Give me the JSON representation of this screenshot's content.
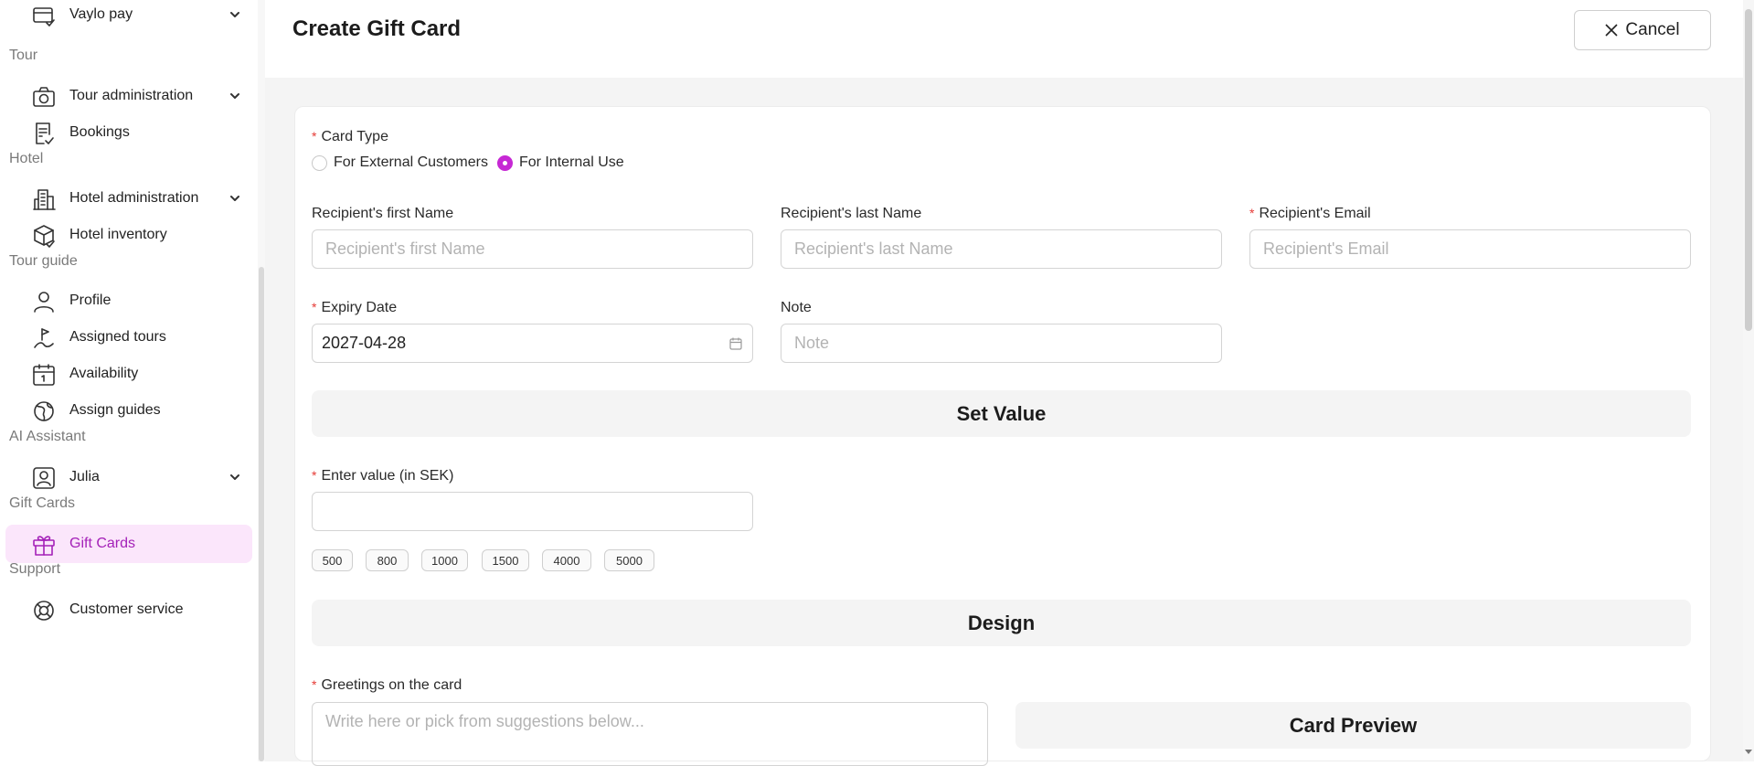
{
  "sidebar": {
    "items": [
      {
        "type": "item",
        "label": "Vaylo pay",
        "icon": "card-check-icon",
        "chevron": true
      },
      {
        "type": "section",
        "label": "Tour"
      },
      {
        "type": "item",
        "label": "Tour administration",
        "icon": "camera-icon",
        "chevron": true
      },
      {
        "type": "item",
        "label": "Bookings",
        "icon": "document-check-icon"
      },
      {
        "type": "section",
        "label": "Hotel"
      },
      {
        "type": "item",
        "label": "Hotel administration",
        "icon": "building-icon",
        "chevron": true
      },
      {
        "type": "item",
        "label": "Hotel inventory",
        "icon": "box-check-icon"
      },
      {
        "type": "section",
        "label": "Tour guide"
      },
      {
        "type": "item",
        "label": "Profile",
        "icon": "user-icon"
      },
      {
        "type": "item",
        "label": "Assigned tours",
        "icon": "flag-route-icon"
      },
      {
        "type": "item",
        "label": "Availability",
        "icon": "calendar-icon"
      },
      {
        "type": "item",
        "label": "Assign guides",
        "icon": "globe-icon"
      },
      {
        "type": "section",
        "label": "AI Assistant"
      },
      {
        "type": "item",
        "label": "Julia",
        "icon": "user-square-icon",
        "chevron": true
      },
      {
        "type": "section",
        "label": "Gift Cards"
      },
      {
        "type": "item",
        "label": "Gift Cards",
        "icon": "gift-icon",
        "active": true
      },
      {
        "type": "section",
        "label": "Support"
      },
      {
        "type": "item",
        "label": "Customer service",
        "icon": "lifebuoy-icon"
      }
    ]
  },
  "header": {
    "title": "Create Gift Card",
    "cancel_label": "Cancel"
  },
  "form": {
    "card_type": {
      "label": "Card Type",
      "options": [
        "For External Customers",
        "For Internal Use"
      ],
      "selected": "For Internal Use"
    },
    "first_name": {
      "label": "Recipient's first Name",
      "placeholder": "Recipient's first Name",
      "value": ""
    },
    "last_name": {
      "label": "Recipient's last Name",
      "placeholder": "Recipient's last Name",
      "value": ""
    },
    "email": {
      "label": "Recipient's Email",
      "placeholder": "Recipient's Email",
      "value": ""
    },
    "expiry": {
      "label": "Expiry Date",
      "value": "2027-04-28"
    },
    "note": {
      "label": "Note",
      "placeholder": "Note",
      "value": ""
    },
    "set_value_title": "Set Value",
    "value_field": {
      "label": "Enter value (in SEK)",
      "value": ""
    },
    "value_chips": [
      "500",
      "800",
      "1000",
      "1500",
      "4000",
      "5000"
    ],
    "design_title": "Design",
    "greetings": {
      "label": "Greetings on the card",
      "placeholder": "Write here or pick from suggestions below..."
    },
    "preview_title": "Card Preview"
  },
  "colors": {
    "accent": "#c628d4",
    "active_bg": "#fbe6fb",
    "required": "#e53935"
  }
}
